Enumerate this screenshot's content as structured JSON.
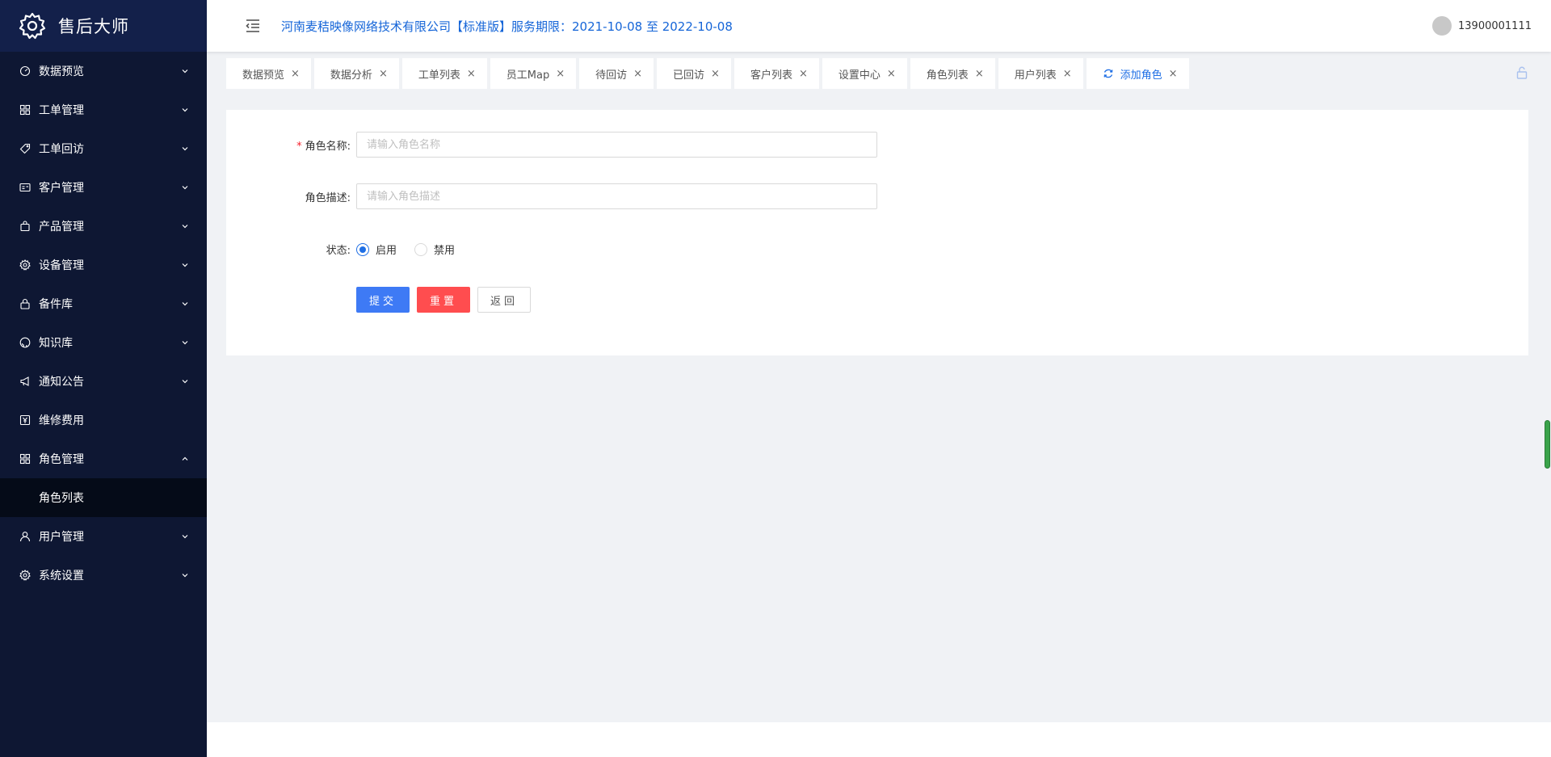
{
  "app": {
    "title": "售后大师"
  },
  "sidebar": {
    "items": [
      {
        "label": "数据预览",
        "icon": "dashboard-icon",
        "expanded": false
      },
      {
        "label": "工单管理",
        "icon": "grid-icon",
        "expanded": false
      },
      {
        "label": "工单回访",
        "icon": "tag-icon",
        "expanded": false
      },
      {
        "label": "客户管理",
        "icon": "id-card-icon",
        "expanded": false
      },
      {
        "label": "产品管理",
        "icon": "bag-icon",
        "expanded": false
      },
      {
        "label": "设备管理",
        "icon": "gear-icon",
        "expanded": false
      },
      {
        "label": "备件库",
        "icon": "lock-icon",
        "expanded": false
      },
      {
        "label": "知识库",
        "icon": "github-icon",
        "expanded": false
      },
      {
        "label": "通知公告",
        "icon": "megaphone-icon",
        "expanded": false
      },
      {
        "label": "维修费用",
        "icon": "yen-icon",
        "expanded": false
      },
      {
        "label": "角色管理",
        "icon": "grid-icon",
        "expanded": true,
        "children": [
          "角色列表"
        ]
      },
      {
        "label": "用户管理",
        "icon": "user-icon",
        "expanded": false
      },
      {
        "label": "系统设置",
        "icon": "gear-icon",
        "expanded": false
      }
    ]
  },
  "header": {
    "company": "河南麦秸映像网络技术有限公司【标准版】服务期限：2021-10-08 至 2022-10-08",
    "username": "13900001111"
  },
  "tabs": [
    {
      "label": "数据预览",
      "active": false
    },
    {
      "label": "数据分析",
      "active": false
    },
    {
      "label": "工单列表",
      "active": false
    },
    {
      "label": "员工Map",
      "active": false
    },
    {
      "label": "待回访",
      "active": false
    },
    {
      "label": "已回访",
      "active": false
    },
    {
      "label": "客户列表",
      "active": false
    },
    {
      "label": "设置中心",
      "active": false
    },
    {
      "label": "角色列表",
      "active": false
    },
    {
      "label": "用户列表",
      "active": false
    },
    {
      "label": "添加角色",
      "active": true
    }
  ],
  "form": {
    "name_label": "角色名称:",
    "name_placeholder": "请输入角色名称",
    "name_value": "",
    "desc_label": "角色描述:",
    "desc_placeholder": "请输入角色描述",
    "desc_value": "",
    "status_label": "状态:",
    "status_options": [
      "启用",
      "禁用"
    ],
    "status_selected": "启用",
    "submit_label": "提交",
    "reset_label": "重置",
    "back_label": "返回"
  },
  "colors": {
    "sidebar_bg": "#0e1733",
    "primary": "#3e7af5",
    "danger": "#ff4d4f",
    "link": "#1565d8"
  }
}
